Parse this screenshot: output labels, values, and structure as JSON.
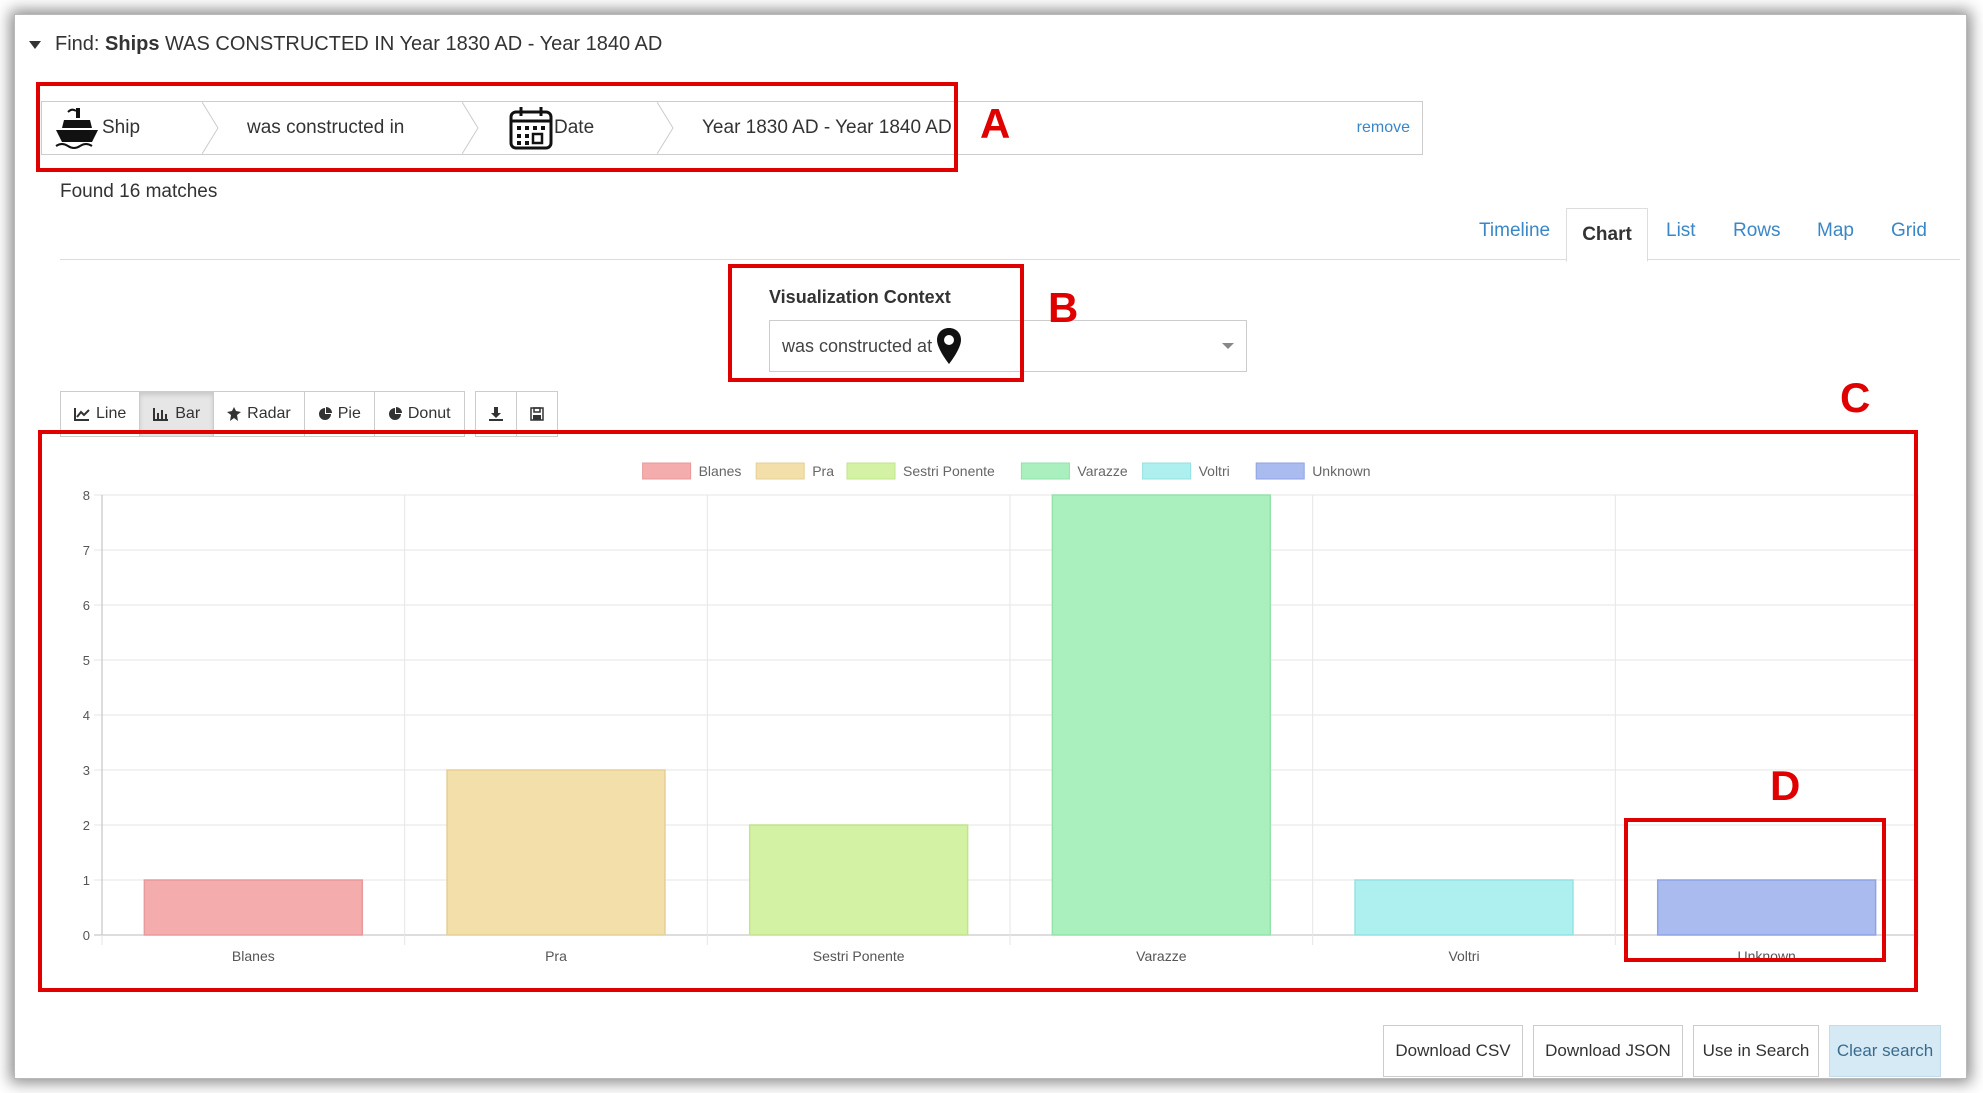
{
  "find": {
    "prefix": "Find:",
    "entity": "Ships",
    "rest": "WAS CONSTRUCTED IN Year 1830 AD - Year 1840 AD"
  },
  "breadcrumb": {
    "items": [
      {
        "label": "Ship",
        "icon": "ship-icon"
      },
      {
        "label": "was constructed in"
      },
      {
        "label": "Date",
        "icon": "calendar-icon"
      },
      {
        "label": "Year 1830 AD - Year 1840 AD"
      }
    ],
    "remove": "remove"
  },
  "found": "Found 16 matches",
  "tabs": [
    "Timeline",
    "Chart",
    "List",
    "Rows",
    "Map",
    "Grid"
  ],
  "active_tab": "Chart",
  "viz_context": {
    "label": "Visualization Context",
    "value": "was constructed at",
    "icon": "map-marker-icon"
  },
  "chart_buttons": [
    {
      "label": "Line",
      "icon": "line-chart-icon"
    },
    {
      "label": "Bar",
      "icon": "bar-chart-icon",
      "active": true
    },
    {
      "label": "Radar",
      "icon": "radar-icon"
    },
    {
      "label": "Pie",
      "icon": "pie-icon"
    },
    {
      "label": "Donut",
      "icon": "donut-icon"
    }
  ],
  "tool_buttons": [
    {
      "icon": "download-icon"
    },
    {
      "icon": "save-icon"
    }
  ],
  "chart_data": {
    "type": "bar",
    "categories": [
      "Blanes",
      "Pra",
      "Sestri Ponente",
      "Varazze",
      "Voltri",
      "Unknown"
    ],
    "values": [
      1,
      3,
      2,
      8,
      1,
      1
    ],
    "legend": [
      "Blanes",
      "Pra",
      "Sestri Ponente",
      "Varazze",
      "Voltri",
      "Unknown"
    ],
    "legend_position": "top",
    "colors": [
      "#f4acac",
      "#f3dfaa",
      "#d4f2a4",
      "#aaf0bf",
      "#aef0f0",
      "#aabbf0"
    ],
    "borders": [
      "#e99a9a",
      "#e6cf95",
      "#c1e48d",
      "#93e2ab",
      "#94e2e2",
      "#8ea3e6"
    ],
    "ylim": [
      0,
      8
    ],
    "yticks": [
      0,
      1,
      2,
      3,
      4,
      5,
      6,
      7,
      8
    ],
    "grid": true
  },
  "annotations": {
    "a": "A",
    "b": "B",
    "c": "C",
    "d": "D"
  },
  "annotation_color": "#e00000",
  "footer": [
    "Download CSV",
    "Download JSON",
    "Use in Search",
    "Clear search"
  ]
}
